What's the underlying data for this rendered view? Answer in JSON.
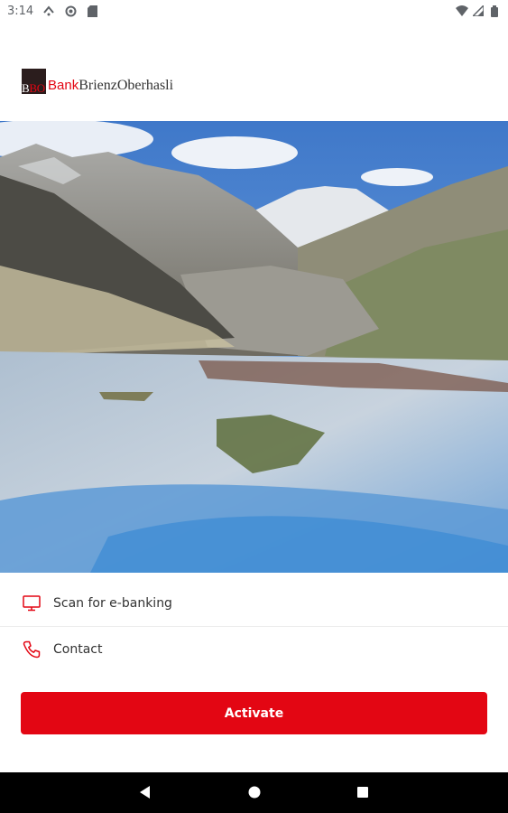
{
  "status_bar": {
    "time": "3:14"
  },
  "logo": {
    "mark_black": "B",
    "mark_red": "BO",
    "word_red": "Bank",
    "word_dark": "BrienzOberhasli"
  },
  "menu": {
    "items": [
      {
        "label": "Scan for e-banking",
        "icon": "monitor-icon"
      },
      {
        "label": "Contact",
        "icon": "phone-icon"
      }
    ]
  },
  "activate_button": {
    "label": "Activate"
  },
  "colors": {
    "brand_red": "#e30613"
  }
}
